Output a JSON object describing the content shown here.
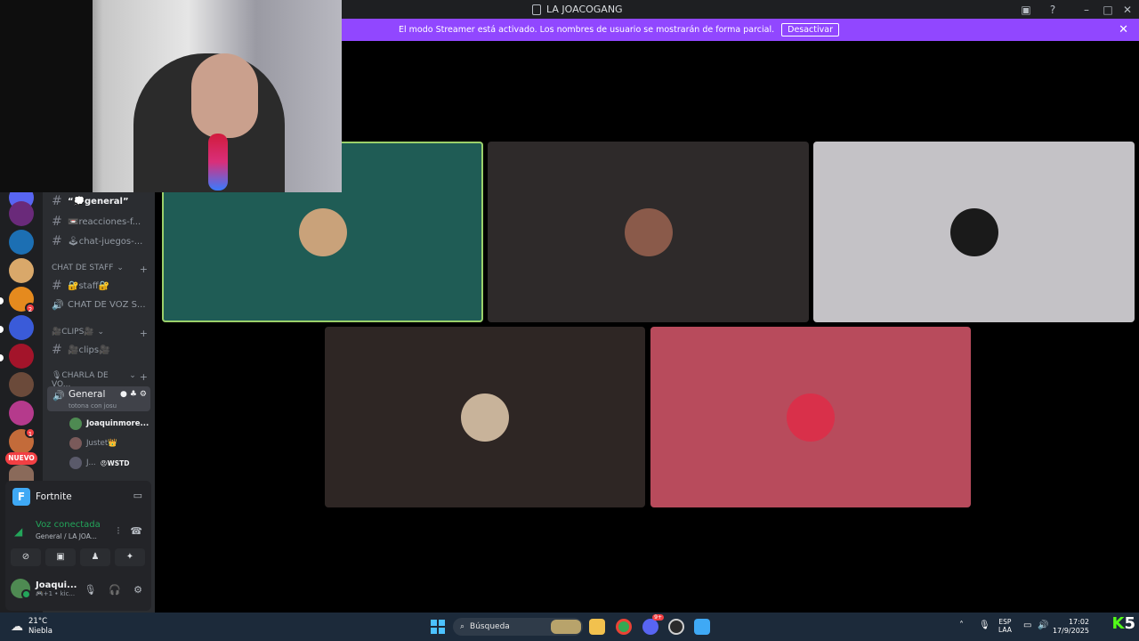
{
  "titlebar": {
    "title": "LA JOACOGANG"
  },
  "banner": {
    "message": "El modo Streamer está activado. Los nombres de usuario se mostrarán de forma parcial.",
    "button": "Desactivar"
  },
  "servers": {
    "badges": [
      "2",
      "1"
    ],
    "new_label": "NUEVO"
  },
  "channels": {
    "text_channels": [
      {
        "label": "“💭general”"
      },
      {
        "label": "📼reacciones-f..."
      },
      {
        "label": "🕹chat-juegos-..."
      }
    ],
    "categories": [
      {
        "label": "CHAT DE STAFF"
      },
      {
        "label": "🎥CLIPS🎥"
      },
      {
        "label": "🎙CHARLA DE VO..."
      }
    ],
    "staff_channels": [
      {
        "label": "🔐staff🔐"
      },
      {
        "label": "CHAT DE VOZ S..."
      }
    ],
    "clips_channel": {
      "label": "🎥clips🎥"
    },
    "voice_channel": {
      "name": "General",
      "subtitle": "totona con josu"
    },
    "voice_users": [
      {
        "name": "Joaquinmore..."
      },
      {
        "name": "Justet👑"
      },
      {
        "name": "J...",
        "suffix": "😠WSTD"
      }
    ]
  },
  "activity": {
    "game": "Fortnite",
    "icon_letter": "F"
  },
  "voice_status": {
    "status": "Voz conectada",
    "location": "General / LA JOA..."
  },
  "user": {
    "name": "Joaqui...",
    "sub": "🎮+1 • kic..."
  },
  "tiles": [
    {
      "color": "#1f5c55",
      "avatar_color": "#c9a27a",
      "speaking": true
    },
    {
      "color": "#2e2a2a",
      "avatar_color": "#8a5a4a",
      "speaking": false
    },
    {
      "color": "#c4c2c6",
      "avatar_color": "#1a1a1a",
      "speaking": false
    },
    {
      "color": "#2e2624",
      "avatar_color": "#c8b39a",
      "speaking": false
    },
    {
      "color": "#b84b5c",
      "avatar_color": "#d9304a",
      "speaking": false
    }
  ],
  "taskbar": {
    "weather_temp": "21°C",
    "weather_desc": "Niebla",
    "search_placeholder": "Búsqueda",
    "lang_top": "ESP",
    "lang_bottom": "LAA",
    "time": "17:02",
    "date": "17/9/2025",
    "discord_badge": "9+",
    "kick_number": "5"
  }
}
